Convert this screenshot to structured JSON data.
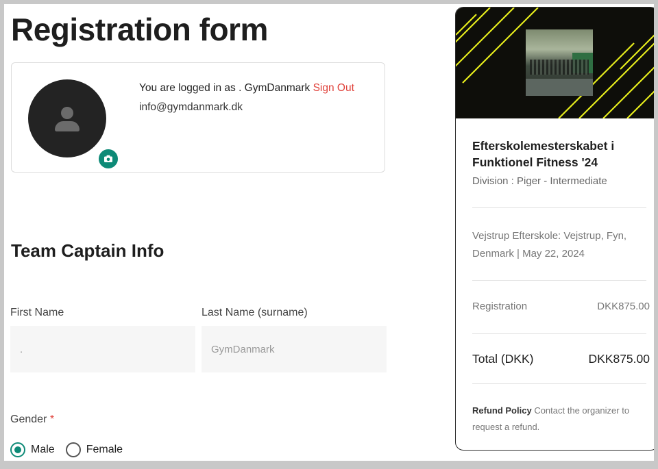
{
  "page": {
    "title": "Registration form"
  },
  "profile": {
    "logged_in_prefix": "You are logged in as . GymDanmark ",
    "sign_out": "Sign Out",
    "email": "info@gymdanmark.dk"
  },
  "team_captain": {
    "section_title": "Team Captain Info",
    "first_name_label": "First Name",
    "first_name_value": ".",
    "last_name_label": "Last Name (surname)",
    "last_name_value": "GymDanmark",
    "gender_label": "Gender",
    "required_mark": "*",
    "gender_options": [
      {
        "label": "Male",
        "checked": true
      },
      {
        "label": "Female",
        "checked": false
      }
    ]
  },
  "summary": {
    "event_title": "Efterskolemesterskabet i Funktionel Fitness '24",
    "division": "Division : Piger - Intermediate",
    "venue": "Vejstrup Efterskole: Vejstrup, Fyn, Denmark | May 22, 2024",
    "registration_label": "Registration",
    "registration_value": "DKK875.00",
    "total_label": "Total (DKK)",
    "total_value": "DKK875.00",
    "refund_policy_label": "Refund Policy",
    "refund_policy_text": "Contact the organizer to request a refund."
  },
  "colors": {
    "accent": "#0d8a77",
    "danger": "#e0413a",
    "banner_bg": "#0e0e0a",
    "banner_stripes": "#e6ec1c"
  },
  "icons": {
    "avatar": "person-icon",
    "camera": "camera-icon"
  }
}
